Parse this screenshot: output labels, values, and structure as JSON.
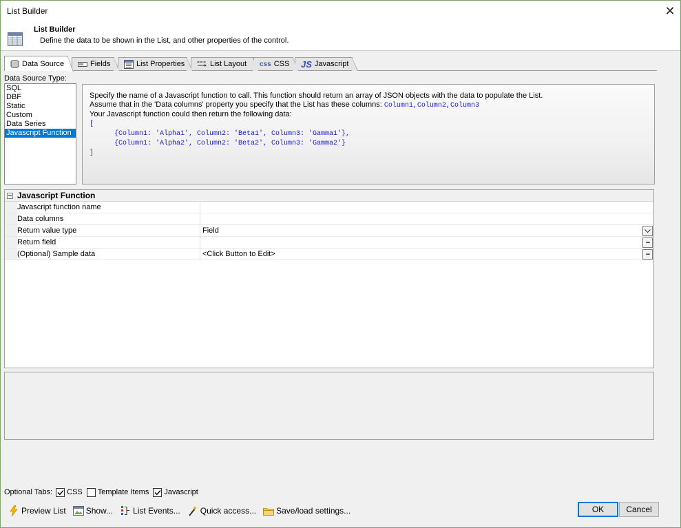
{
  "window": {
    "title": "List Builder",
    "close_glyph": "✕"
  },
  "header": {
    "title": "List Builder",
    "subtitle": "Define the data to be shown in the List, and other properties of the control."
  },
  "tabs": [
    {
      "label": "Data Source",
      "icon": "database-icon",
      "active": true
    },
    {
      "label": "Fields",
      "icon": "field-icon"
    },
    {
      "label": "List Properties",
      "icon": "properties-icon"
    },
    {
      "label": "List Layout",
      "icon": "layout-icon"
    },
    {
      "label": "CSS",
      "icon": "css-icon",
      "icon_text": "css"
    },
    {
      "label": "Javascript",
      "icon": "js-icon",
      "icon_text": "JS"
    }
  ],
  "data_source": {
    "label": "Data Source Type:",
    "items": [
      "SQL",
      "DBF",
      "Static",
      "Custom",
      "Data Series",
      "Javascript Function"
    ],
    "selected": "Javascript Function"
  },
  "description": {
    "line1": "Specify the name of a Javascript function to call. This function should return an array of JSON objects with the data to populate the List.",
    "line2_prefix": "Assume that in the 'Data columns' property you specify that the List has these columns: ",
    "line2_columns": "Column1,Column2,Column3",
    "line3": "Your Javascript function could then return the following data:",
    "code": "[\n      {Column1: 'Alpha1', Column2: 'Beta1', Column3: 'Gamma1'},\n      {Column1: 'Alpha2', Column2: 'Beta2', Column3: 'Gamma2'}\n]"
  },
  "property_grid": {
    "category": "Javascript Function",
    "rows": [
      {
        "name": "Javascript function name",
        "value": ""
      },
      {
        "name": "Data columns",
        "value": ""
      },
      {
        "name": "Return value type",
        "value": "Field",
        "button": "dropdown"
      },
      {
        "name": "Return field",
        "value": "",
        "button": "..."
      },
      {
        "name": "(Optional) Sample data",
        "value": "<Click Button to Edit>",
        "button": "..."
      }
    ]
  },
  "optional_tabs": {
    "label": "Optional Tabs:",
    "items": [
      {
        "label": "CSS",
        "checked": true
      },
      {
        "label": "Template Items",
        "checked": false
      },
      {
        "label": "Javascript",
        "checked": true
      }
    ]
  },
  "toolbar": {
    "preview": "Preview List",
    "show": "Show...",
    "list_events": "List Events...",
    "quick_access": "Quick access...",
    "save_load": "Save/load settings..."
  },
  "buttons": {
    "ok": "OK",
    "cancel": "Cancel"
  },
  "colors": {
    "selection": "#0078d7",
    "code": "#1a1ad0",
    "window_border": "#7ba36a"
  }
}
